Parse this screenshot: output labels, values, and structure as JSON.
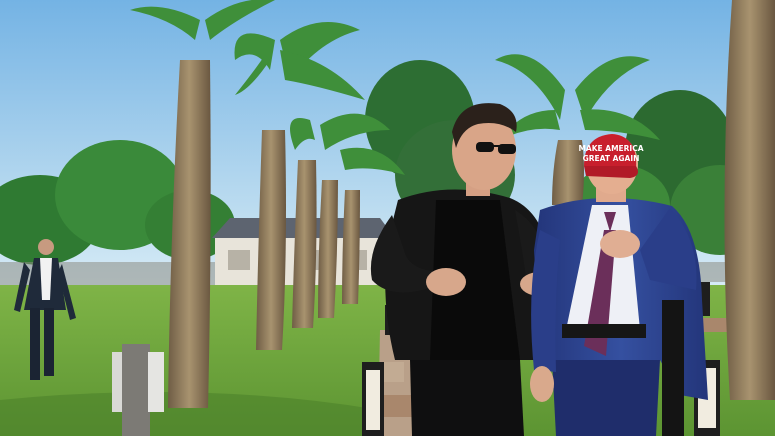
{
  "photo": {
    "hat_text_line1": "MAKE AMERICA",
    "hat_text_line2": "GREAT AGAIN"
  },
  "colors": {
    "sky_top": "#7db9e6",
    "sky_bottom": "#cfe6f4",
    "grass": "#6fa63d",
    "grass_dark": "#4f8a2c",
    "palm_trunk": "#9a8566",
    "palm_frond": "#3f8f3a",
    "suit_navy": "#2b3f8a",
    "jacket_black": "#161616",
    "hat_red": "#c81f2d",
    "tie": "#6b2f5a"
  }
}
